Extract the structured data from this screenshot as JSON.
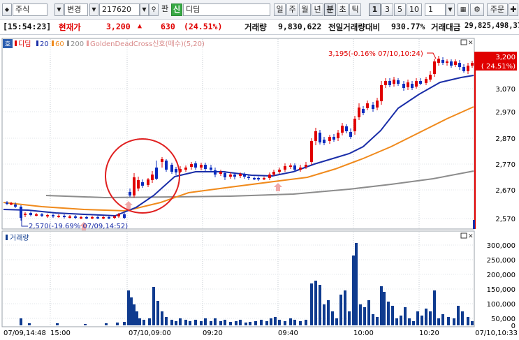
{
  "toolbar": {
    "market": "주식",
    "change_label": "변경",
    "code": "217620",
    "pan_label": "판",
    "credit_badge": "신",
    "stock_name": "디딤",
    "period_buttons": [
      "일",
      "주",
      "월",
      "년",
      "분",
      "초",
      "틱"
    ],
    "active_period": "분",
    "interval_buttons": [
      "1",
      "3",
      "5",
      "10"
    ],
    "active_interval": "1",
    "interval_value": "1",
    "order_label": "주문",
    "icons": [
      "settings-icon",
      "add-icon"
    ]
  },
  "quote_bar": {
    "time": "[15:54:23]",
    "current_price_label": "현재가",
    "current_price": "3,200",
    "change": "630",
    "change_rate": "(24.51%)",
    "volume_label": "거래량",
    "volume": "9,830,622",
    "prev_volume_ratio_label": "전일거래량대비",
    "prev_volume_ratio": "930.77%",
    "amount_label": "거래대금",
    "amount": "29,825,498,370",
    "up_color": "#e00000"
  },
  "price_panel": {
    "corner_label": "호",
    "legend": [
      {
        "text": "디딤",
        "color": "#e00000"
      },
      {
        "text": "20",
        "color": "#1a2ea8"
      },
      {
        "text": "60",
        "color": "#f08a1c"
      },
      {
        "text": "200",
        "color": "#8c8c8c"
      },
      {
        "text": "GoldenDeadCross신호(매수)(5,20)",
        "color": "#e8a0a0"
      }
    ],
    "high_annotation": "3,195(-0.16% 07/10,10:24)",
    "low_annotation": "2,570(-19.69% 07/09,14:52)",
    "current_price_tag": "3,200",
    "current_rate_tag": "( 24.51%)",
    "y_ticks": [
      "3,070",
      "2,970",
      "2,870",
      "2,770",
      "2,670",
      "2,570"
    ]
  },
  "volume_panel": {
    "legend": "거래량",
    "y_ticks": [
      "300,000",
      "250,000",
      "200,000",
      "150,000",
      "100,000",
      "50,000",
      "0"
    ]
  },
  "x_axis": {
    "labels": [
      "07/09,14:48",
      "15:00",
      "07/10,09:00",
      "09:20",
      "09:40",
      "10:00",
      "10:20",
      "07/10,10:33"
    ]
  },
  "colors": {
    "up": "#e00000",
    "down": "#0a2cbf",
    "ma20": "#1a2ea8",
    "ma60": "#f08a1c",
    "ma200": "#8c8c8c",
    "volume_bar": "#0f3b8f",
    "highlight_circle": "#e02020"
  }
}
